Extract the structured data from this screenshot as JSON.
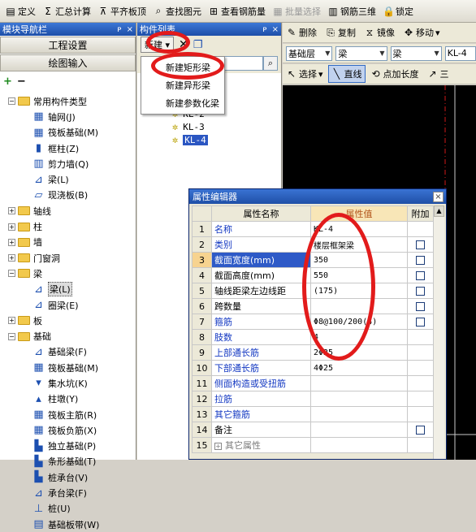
{
  "top_toolbar": {
    "define": "定义",
    "summary": "汇总计算",
    "align_top": "平齐板顶",
    "find": "查找图元",
    "view_rebar": "查看钢筋量",
    "batch_select": "批量选择",
    "rebar_3d": "钢筋三维",
    "lock": "锁定"
  },
  "left_panel": {
    "title": "模块导航栏",
    "pin": "ņ",
    "close": "×",
    "project_settings": "工程设置",
    "drawing_input": "绘图输入",
    "tree": [
      {
        "label": "常用构件类型",
        "level": 0,
        "kind": "folder",
        "expander": "−"
      },
      {
        "label": "轴网(J)",
        "level": 1,
        "kind": "comp",
        "icon": "▦"
      },
      {
        "label": "筏板基础(M)",
        "level": 1,
        "kind": "comp",
        "icon": "▦"
      },
      {
        "label": "框柱(Z)",
        "level": 1,
        "kind": "comp",
        "icon": "▮"
      },
      {
        "label": "剪力墙(Q)",
        "level": 1,
        "kind": "comp",
        "icon": "▥"
      },
      {
        "label": "梁(L)",
        "level": 1,
        "kind": "comp",
        "icon": "⊿"
      },
      {
        "label": "现浇板(B)",
        "level": 1,
        "kind": "comp",
        "icon": "▱"
      },
      {
        "label": "轴线",
        "level": 0,
        "kind": "folder",
        "expander": "+"
      },
      {
        "label": "柱",
        "level": 0,
        "kind": "folder",
        "expander": "+"
      },
      {
        "label": "墙",
        "level": 0,
        "kind": "folder",
        "expander": "+"
      },
      {
        "label": "门窗洞",
        "level": 0,
        "kind": "folder",
        "expander": "+"
      },
      {
        "label": "梁",
        "level": 0,
        "kind": "folder",
        "expander": "−"
      },
      {
        "label": "梁(L)",
        "level": 1,
        "kind": "comp",
        "icon": "⊿",
        "selected": true
      },
      {
        "label": "圈梁(E)",
        "level": 1,
        "kind": "comp",
        "icon": "⊿"
      },
      {
        "label": "板",
        "level": 0,
        "kind": "folder",
        "expander": "+"
      },
      {
        "label": "基础",
        "level": 0,
        "kind": "folder",
        "expander": "−"
      },
      {
        "label": "基础梁(F)",
        "level": 1,
        "kind": "comp",
        "icon": "⊿"
      },
      {
        "label": "筏板基础(M)",
        "level": 1,
        "kind": "comp",
        "icon": "▦"
      },
      {
        "label": "集水坑(K)",
        "level": 1,
        "kind": "comp",
        "icon": "▾"
      },
      {
        "label": "柱墩(Y)",
        "level": 1,
        "kind": "comp",
        "icon": "▴"
      },
      {
        "label": "筏板主筋(R)",
        "level": 1,
        "kind": "comp",
        "icon": "▦"
      },
      {
        "label": "筏板负筋(X)",
        "level": 1,
        "kind": "comp",
        "icon": "▦"
      },
      {
        "label": "独立基础(P)",
        "level": 1,
        "kind": "comp",
        "icon": "▙"
      },
      {
        "label": "条形基础(T)",
        "level": 1,
        "kind": "comp",
        "icon": "▙"
      },
      {
        "label": "桩承台(V)",
        "level": 1,
        "kind": "comp",
        "icon": "▙"
      },
      {
        "label": "承台梁(F)",
        "level": 1,
        "kind": "comp",
        "icon": "⊿"
      },
      {
        "label": "桩(U)",
        "level": 1,
        "kind": "comp",
        "icon": "⊥"
      },
      {
        "label": "基础板带(W)",
        "level": 1,
        "kind": "comp",
        "icon": "▤"
      }
    ]
  },
  "component_list": {
    "title": "构件列表",
    "pin": "ņ",
    "close": "×",
    "new_label": "新建",
    "new_menu": [
      "新建矩形梁",
      "新建异形梁",
      "新建参数化梁"
    ],
    "items": [
      {
        "label": "KL-2",
        "selected": false
      },
      {
        "label": "KL-3",
        "selected": false
      },
      {
        "label": "KL-4",
        "selected": true
      }
    ]
  },
  "right_toolbar": {
    "delete": "删除",
    "copy": "复制",
    "mirror": "镜像",
    "move": "移动",
    "layer_combo": "基础层",
    "type_combo": "梁",
    "sub_combo": "梁",
    "name_combo": "KL-4",
    "select": "选择",
    "line": "直线",
    "point_length": "点加长度",
    "three": "三"
  },
  "property_editor": {
    "title": "属性编辑器",
    "col_name": "属性名称",
    "col_value": "属性值",
    "col_extra": "附加",
    "rows": [
      {
        "num": "1",
        "name": "名称",
        "value": "KL-4",
        "blue": true,
        "check": false
      },
      {
        "num": "2",
        "name": "类别",
        "value": "楼层框架梁",
        "blue": true,
        "check": true
      },
      {
        "num": "3",
        "name": "截面宽度(mm)",
        "value": "350",
        "blue": true,
        "check": true,
        "selected": true
      },
      {
        "num": "4",
        "name": "截面高度(mm)",
        "value": "550",
        "blue": false,
        "check": true
      },
      {
        "num": "5",
        "name": "轴线距梁左边线距",
        "value": "(175)",
        "blue": false,
        "check": true
      },
      {
        "num": "6",
        "name": "跨数量",
        "value": "",
        "blue": false,
        "check": true
      },
      {
        "num": "7",
        "name": "箍筋",
        "value": "Φ8@100/200(4)",
        "blue": true,
        "check": true
      },
      {
        "num": "8",
        "name": "肢数",
        "value": "4",
        "blue": true,
        "check": false
      },
      {
        "num": "9",
        "name": "上部通长筋",
        "value": "2Φ25",
        "blue": true,
        "check": false
      },
      {
        "num": "10",
        "name": "下部通长筋",
        "value": "4Φ25",
        "blue": true,
        "check": false
      },
      {
        "num": "11",
        "name": "侧面构造或受扭筋",
        "value": "",
        "blue": true,
        "check": false
      },
      {
        "num": "12",
        "name": "拉筋",
        "value": "",
        "blue": true,
        "check": false
      },
      {
        "num": "13",
        "name": "其它箍筋",
        "value": "",
        "blue": true,
        "check": false
      },
      {
        "num": "14",
        "name": "备注",
        "value": "",
        "blue": false,
        "check": true
      },
      {
        "num": "15",
        "name": "其它属性",
        "value": "",
        "blue": false,
        "check": false,
        "group": true
      }
    ]
  },
  "colors": {
    "annotation_red": "#e21b1b",
    "title_blue": "#1f4fa7",
    "selection_blue": "#2e5ac7",
    "canvas_black": "#000000"
  }
}
